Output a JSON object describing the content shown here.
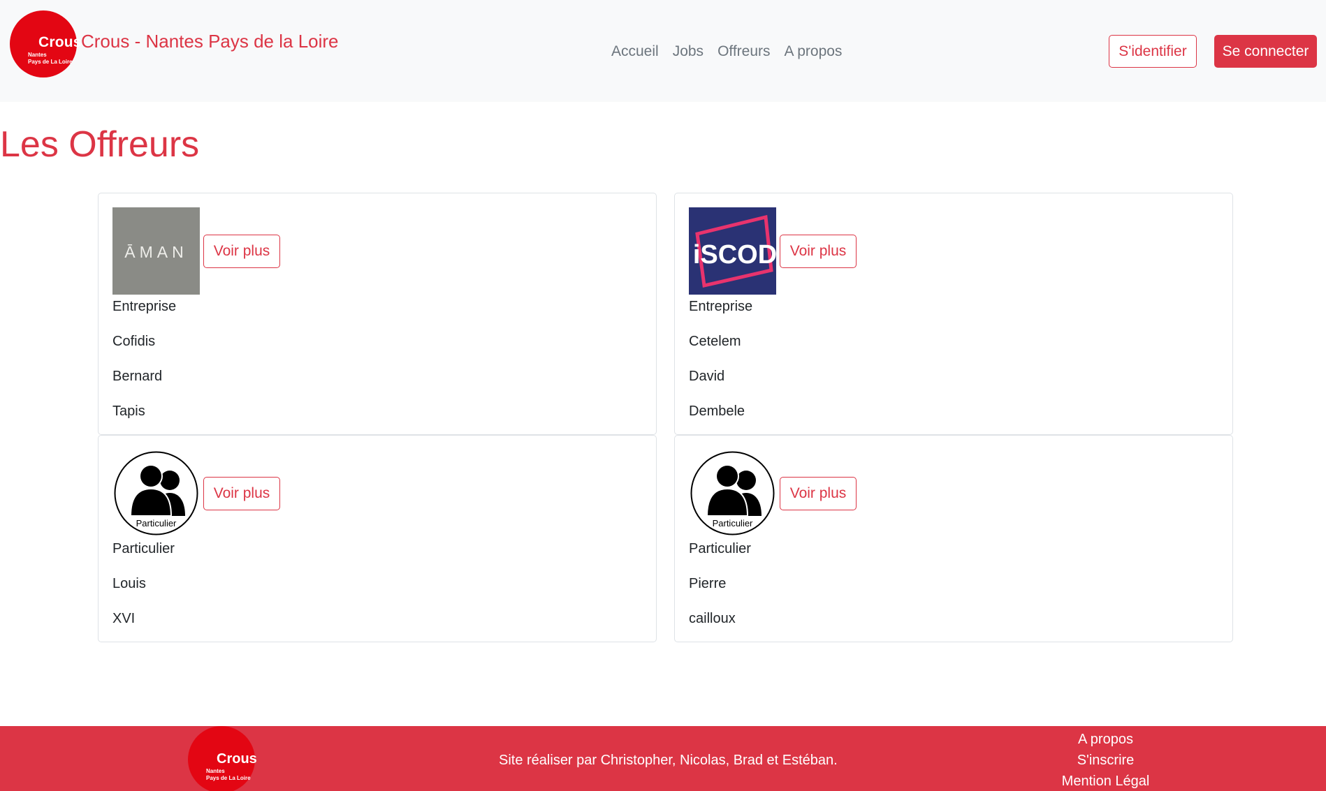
{
  "header": {
    "logo": {
      "word": "Crous",
      "line1": "Nantes",
      "line2": "Pays de La Loire"
    },
    "title": "Crous - Nantes Pays de la Loire",
    "nav": [
      {
        "label": "Accueil"
      },
      {
        "label": "Jobs"
      },
      {
        "label": "Offreurs"
      },
      {
        "label": "A propos"
      }
    ],
    "identify_label": "S'identifier",
    "connect_label": "Se connecter"
  },
  "main": {
    "title": "Les Offreurs",
    "cards": [
      {
        "image": "aman-logo",
        "image_text": "ĀMAN",
        "button": "Voir plus",
        "lines": [
          "Entreprise",
          "Cofidis",
          "Bernard",
          "Tapis"
        ]
      },
      {
        "image": "iscod-logo",
        "image_text": "iSCOD",
        "button": "Voir plus",
        "lines": [
          "Entreprise",
          "Cetelem",
          "David",
          "Dembele"
        ]
      },
      {
        "image": "particulier-avatar",
        "image_text": "Particulier",
        "button": "Voir plus",
        "lines": [
          "Particulier",
          "Louis",
          "XVI"
        ]
      },
      {
        "image": "particulier-avatar",
        "image_text": "Particulier",
        "button": "Voir plus",
        "lines": [
          "Particulier",
          "Pierre",
          "cailloux"
        ]
      }
    ]
  },
  "footer": {
    "logo": {
      "word": "Crous",
      "line1": "Nantes",
      "line2": "Pays de La Loire"
    },
    "credits": "Site réaliser par Christopher, Nicolas, Brad et Estéban.",
    "links": [
      {
        "label": "A propos"
      },
      {
        "label": "S'inscrire"
      },
      {
        "label": "Mention Légal"
      }
    ]
  },
  "colors": {
    "accent": "#dc3545",
    "logo_red": "#e30613",
    "navbar_bg": "#f8f9fa",
    "iscod_bg": "#2a3274",
    "iscod_frame": "#e8336d",
    "aman_bg": "#8a8b86"
  }
}
